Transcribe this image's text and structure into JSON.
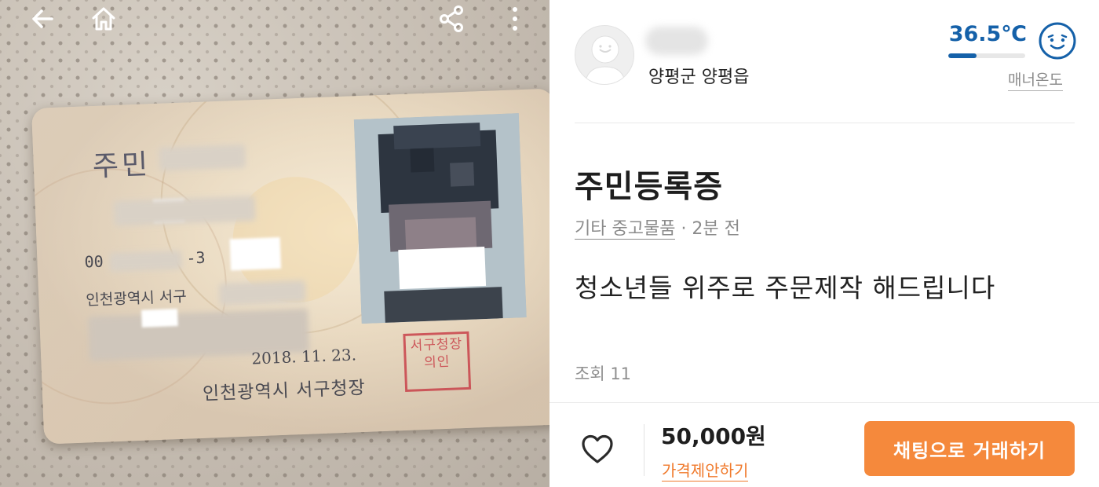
{
  "photo": {
    "icons": [
      "back-arrow-icon",
      "home-icon",
      "share-icon",
      "more-vertical-icon"
    ],
    "id_card": {
      "title_visible": "주민",
      "number_prefix": "00",
      "number_middle": "-3",
      "address_line": "인천광역시 서구",
      "issue_date": "2018. 11. 23.",
      "issuer": "인천광역시 서구청장",
      "seal_text": "서구청장의인"
    }
  },
  "seller": {
    "name": "",
    "location": "양평군 양평읍",
    "manner_temperature": "36.5℃",
    "manner_temperature_fraction": 0.365,
    "manner_label": "매너온도"
  },
  "item": {
    "title": "주민등록증",
    "category": "기타 중고물품",
    "time_ago": "· 2분 전",
    "description": "청소년들 위주로 주문제작 해드립니다",
    "views": "조회 11"
  },
  "footer": {
    "price": "50,000원",
    "offer_label": "가격제안하기",
    "chat_button_label": "채팅으로 거래하기"
  },
  "colors": {
    "accent_orange": "#f5893c",
    "temperature_blue": "#1561a9",
    "text_dark": "#1e1e1e",
    "text_gray": "#8b8b8b"
  }
}
